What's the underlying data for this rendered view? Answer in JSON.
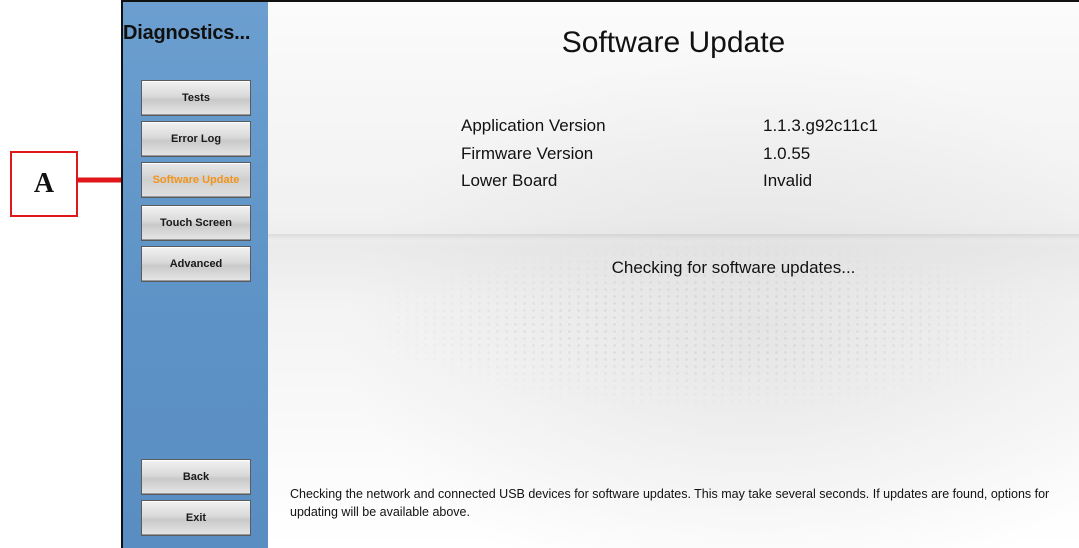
{
  "callout": {
    "label": "A"
  },
  "sidebar": {
    "title": "Diagnostics...",
    "items": [
      {
        "label": "Tests"
      },
      {
        "label": "Error Log"
      },
      {
        "label": "Software Update",
        "active": true
      },
      {
        "label": "Touch Screen"
      },
      {
        "label": "Advanced"
      }
    ],
    "bottom_items": [
      {
        "label": "Back"
      },
      {
        "label": "Exit"
      }
    ]
  },
  "main": {
    "title": "Software Update",
    "info": [
      {
        "label": "Application Version",
        "value": "1.1.3.g92c11c1"
      },
      {
        "label": "Firmware Version",
        "value": "1.0.55"
      },
      {
        "label": "Lower Board",
        "value": "Invalid"
      }
    ],
    "status": "Checking for software updates...",
    "note": "Checking the network and connected USB devices for software updates.  This may take several seconds.  If updates are found, options for updating will be available above."
  },
  "colors": {
    "accent": "#f29419",
    "callout_red": "#e0161b",
    "sidebar_blue": "#6199cc"
  }
}
